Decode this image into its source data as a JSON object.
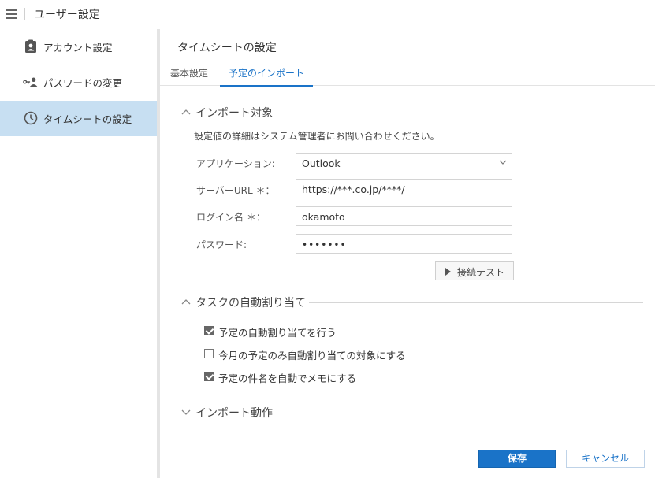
{
  "header": {
    "title": "ユーザー設定"
  },
  "sidebar": {
    "items": [
      {
        "label": "アカウント設定",
        "icon": "account-badge-icon"
      },
      {
        "label": "パスワードの変更",
        "icon": "key-person-icon"
      },
      {
        "label": "タイムシートの設定",
        "icon": "clock-icon",
        "active": true
      }
    ]
  },
  "main": {
    "title": "タイムシートの設定",
    "tabs": [
      {
        "label": "基本設定"
      },
      {
        "label": "予定のインポート",
        "active": true
      }
    ],
    "import_section": {
      "title": "インポート対象",
      "note": "設定値の詳細はシステム管理者にお問い合わせください。",
      "application_label": "アプリケーション:",
      "application_value": "Outlook",
      "server_label": "サーバーURL ＊：",
      "server_value": "https://***.co.jp/****/",
      "login_label": "ログイン名 ＊：",
      "login_value": "okamoto",
      "password_label": "パスワード:",
      "password_value": "•••••••",
      "test_button": "接続テスト"
    },
    "auto_assign_section": {
      "title": "タスクの自動割り当て",
      "options": [
        {
          "label": "予定の自動割り当てを行う",
          "checked": true
        },
        {
          "label": "今月の予定のみ自動割り当ての対象にする",
          "checked": false
        },
        {
          "label": "予定の件名を自動でメモにする",
          "checked": true
        }
      ]
    },
    "import_action_section": {
      "title": "インポート動作"
    },
    "save_button": "保存",
    "cancel_button": "キャンセル"
  },
  "colors": {
    "accent": "#1a73c8",
    "active_sidebar": "#c7dff2"
  }
}
